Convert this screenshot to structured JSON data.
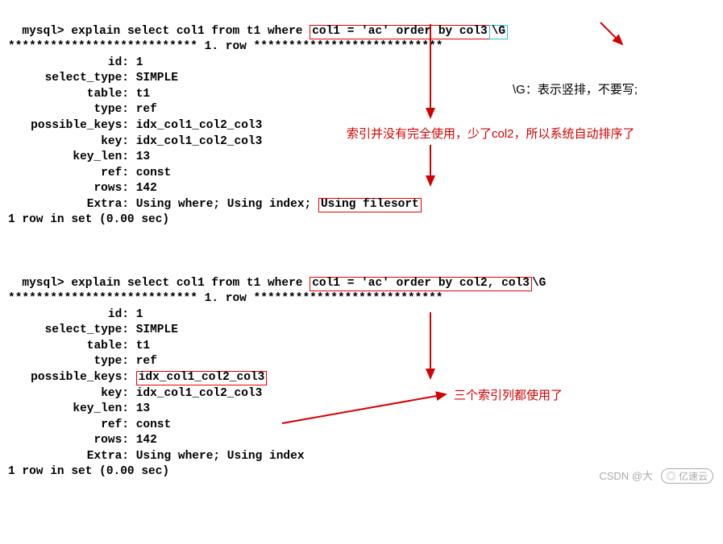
{
  "q1": {
    "prompt": "mysql> ",
    "prefix": "explain select col1 from t1 where ",
    "hl": "col1 = 'ac' order by col3",
    "suffix": "\\G",
    "header": "*************************** 1. row ***************************",
    "fields": {
      "id": "1",
      "select_type": "SIMPLE",
      "table": "t1",
      "type": "ref",
      "possible_keys": "idx_col1_col2_col3",
      "key": "idx_col1_col2_col3",
      "key_len": "13",
      "ref": "const",
      "rows": "142",
      "extra_prefix": "Using where; Using index; ",
      "extra_hl": "Using filesort"
    },
    "footer": "1 row in set (0.00 sec)"
  },
  "q2": {
    "prompt": "mysql> ",
    "prefix": "explain select col1 from t1 where ",
    "hl": "col1 = 'ac' order by col2, col3",
    "suffix": "\\G",
    "header": "*************************** 1. row ***************************",
    "fields": {
      "id": "1",
      "select_type": "SIMPLE",
      "table": "t1",
      "type": "ref",
      "possible_keys_hl": "idx_col1_col2_col3",
      "key": "idx_col1_col2_col3",
      "key_len": "13",
      "ref": "const",
      "rows": "142",
      "extra": "Using where; Using index"
    },
    "footer": "1 row in set (0.00 sec)"
  },
  "labels": {
    "id": "id:",
    "select_type": "select_type:",
    "table": "table:",
    "type": "type:",
    "possible_keys": "possible_keys:",
    "key": "key:",
    "key_len": "key_len:",
    "ref": "ref:",
    "rows": "rows:",
    "extra": "Extra:"
  },
  "anno": {
    "g_note": "\\G：表示竖排，不要写;",
    "a1": "索引并没有完全使用，少了col2，所以系统自动排序了",
    "a2": "三个索引列都使用了"
  },
  "watermark": {
    "csdn": "CSDN @大",
    "badge": "◎ 亿速云"
  }
}
